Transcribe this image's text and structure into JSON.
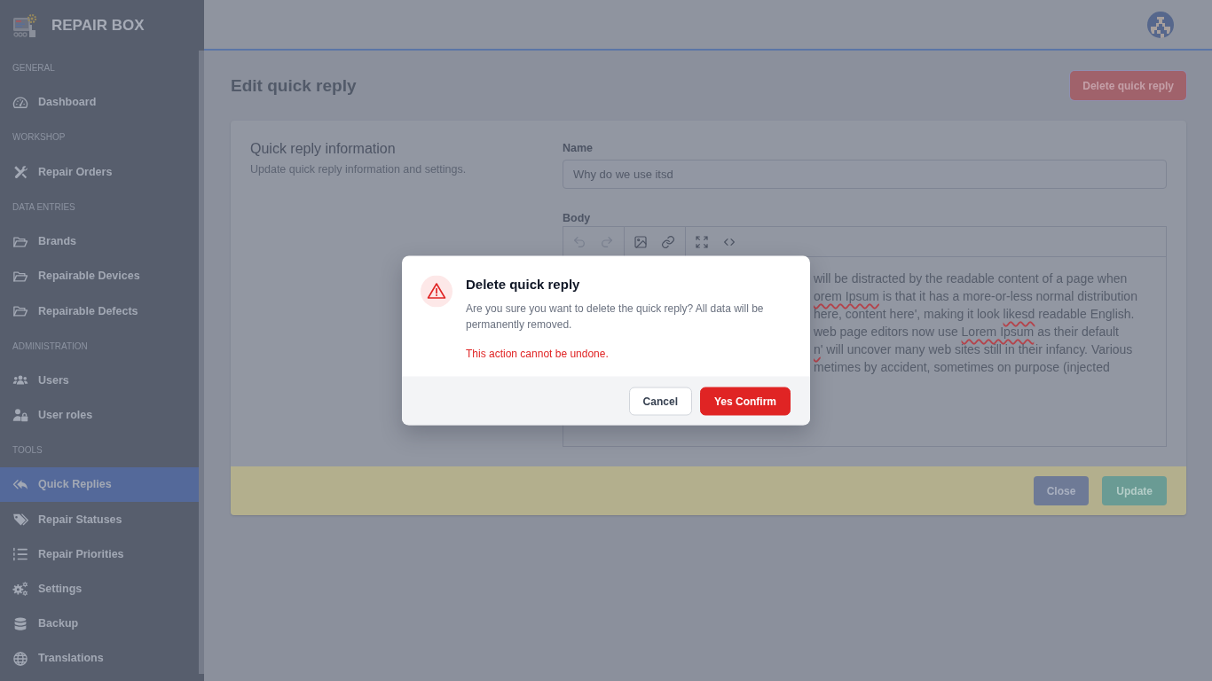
{
  "sidebar": {
    "brand": "REPAIR BOX",
    "sections": [
      {
        "title": "GENERAL",
        "items": [
          {
            "label": "Dashboard",
            "selected": false
          }
        ]
      },
      {
        "title": "WORKSHOP",
        "items": [
          {
            "label": "Repair Orders",
            "selected": false
          }
        ]
      },
      {
        "title": "DATA ENTRIES",
        "items": [
          {
            "label": "Brands",
            "selected": false
          },
          {
            "label": "Repairable Devices",
            "selected": false
          },
          {
            "label": "Repairable Defects",
            "selected": false
          }
        ]
      },
      {
        "title": "ADMINISTRATION",
        "items": [
          {
            "label": "Users",
            "selected": false
          },
          {
            "label": "User roles",
            "selected": false
          }
        ]
      },
      {
        "title": "TOOLS",
        "items": [
          {
            "label": "Quick Replies",
            "selected": true
          },
          {
            "label": "Repair Statuses",
            "selected": false
          },
          {
            "label": "Repair Priorities",
            "selected": false
          },
          {
            "label": "Settings",
            "selected": false
          },
          {
            "label": "Backup",
            "selected": false
          },
          {
            "label": "Translations",
            "selected": false
          }
        ]
      }
    ]
  },
  "page": {
    "title": "Edit quick reply",
    "delete_button": "Delete quick reply"
  },
  "form": {
    "title": "Quick reply information",
    "description": "Update quick reply information and settings.",
    "name": {
      "label": "Name",
      "value": "Why do we use itsd"
    },
    "body": {
      "label": "Body",
      "toolbar": [
        [
          {
            "disabled": true
          },
          {
            "disabled": true
          }
        ],
        [
          {
            "disabled": false
          },
          {
            "disabled": false
          }
        ],
        [
          {
            "disabled": false
          },
          {
            "disabled": false
          }
        ]
      ],
      "lines": [
        {
          "segments": [
            {
              "text": "will be distracted by the readable content of a page when",
              "misspelled": false
            }
          ]
        },
        {
          "segments": [
            {
              "text": "orem Ipsum",
              "misspelled": true
            },
            {
              "text": " is that it has a more-or-less normal distribution",
              "misspelled": false
            }
          ]
        },
        {
          "segments": [
            {
              "text": "here, content here', making it look ",
              "misspelled": false
            },
            {
              "text": "likesd",
              "misspelled": true
            },
            {
              "text": " readable English.",
              "misspelled": false
            }
          ]
        },
        {
          "segments": [
            {
              "text": "web page editors now use ",
              "misspelled": false
            },
            {
              "text": "Lorem Ipsum",
              "misspelled": true
            },
            {
              "text": " as their default",
              "misspelled": false
            }
          ]
        },
        {
          "segments": [
            {
              "text": "n",
              "misspelled": true
            },
            {
              "text": "' will uncover many web sites still in their infancy. Various",
              "misspelled": false
            }
          ]
        },
        {
          "segments": [
            {
              "text": "metimes by accident, sometimes on purpose (injected",
              "misspelled": false
            }
          ]
        }
      ]
    },
    "buttons": [
      {
        "label": "Close",
        "kind": "secondary"
      },
      {
        "label": "Update",
        "kind": "primary"
      }
    ]
  },
  "dialog": {
    "title": "Delete quick reply",
    "message": "Are you sure you want to delete the quick reply? All data will be permanently removed.",
    "warning": "This action cannot be undone.",
    "buttons": [
      {
        "label": "Cancel",
        "kind": "cancel"
      },
      {
        "label": "Yes Confirm",
        "kind": "danger"
      }
    ]
  }
}
